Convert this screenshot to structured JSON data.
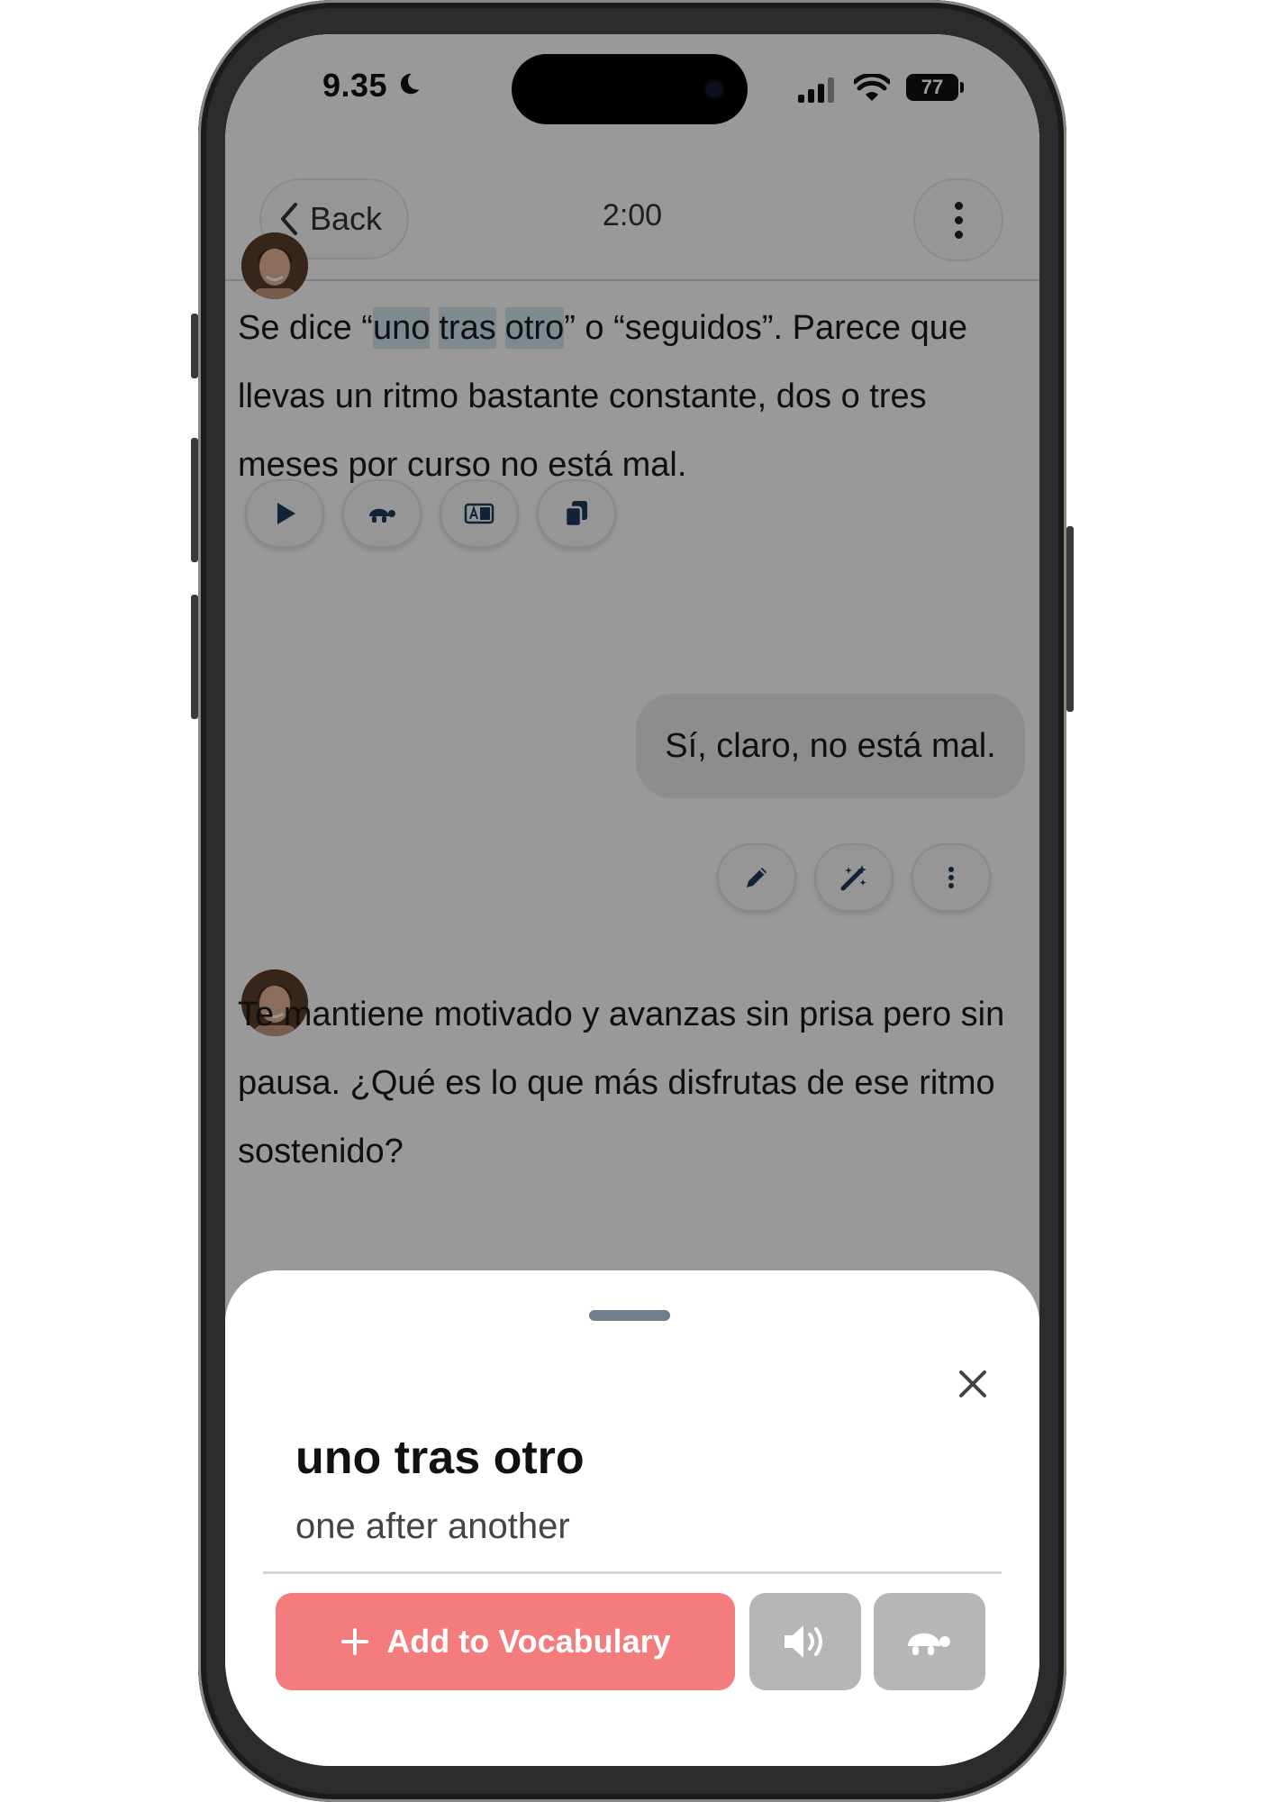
{
  "status_bar": {
    "time": "9.35",
    "battery": "77"
  },
  "nav": {
    "back_label": "Back",
    "timer": "2:00"
  },
  "messages": {
    "bot1": {
      "pre": "Se dice “",
      "phrase_words": [
        "uno",
        "tras",
        "otro"
      ],
      "post": "” o “seguidos”. Parece que llevas un ritmo bastante constante, dos o tres meses por curso no está mal."
    },
    "user1": {
      "text": "Sí, claro, no está mal."
    },
    "bot2": {
      "text": "Te mantiene motivado y avanzas sin prisa pero sin pausa. ¿Qué es lo que más disfrutas de ese ritmo sostenido?"
    }
  },
  "bot_actions": [
    "play-icon",
    "turtle-icon",
    "translate-icon",
    "copy-icon"
  ],
  "user_actions": [
    "pencil-icon",
    "magic-wand-icon",
    "more-vertical-icon"
  ],
  "sheet": {
    "term": "uno tras otro",
    "translation": "one after another",
    "add_label": "Add to Vocabulary"
  },
  "colors": {
    "accent": "#f47c7c",
    "highlight": "#d4e6f0",
    "icon": "#1f3a5c",
    "disabled": "#b6b6b6"
  }
}
